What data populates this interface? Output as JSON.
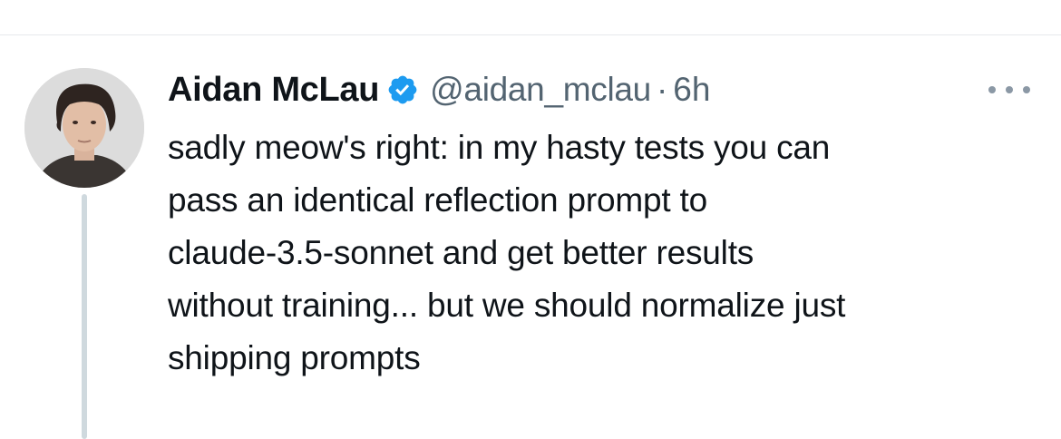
{
  "tweet": {
    "author": {
      "display_name": "Aidan McLau",
      "verified": true,
      "handle": "@aidan_mclau"
    },
    "separator": "·",
    "time_ago": "6h",
    "text_lines": [
      "sadly meow's right: in my hasty tests you can",
      "pass an identical reflection prompt to",
      "claude-3.5-sonnet and get better results",
      "without training... but we should normalize just",
      "shipping prompts"
    ]
  },
  "colors": {
    "text": "#0f1419",
    "secondary_text": "#536471",
    "verified_badge": "#1d9bf0",
    "thread_line": "#cfd9de",
    "divider": "#e6e9ec"
  },
  "icons": {
    "verified": "verified-badge-icon",
    "more": "more-horizontal-icon"
  }
}
